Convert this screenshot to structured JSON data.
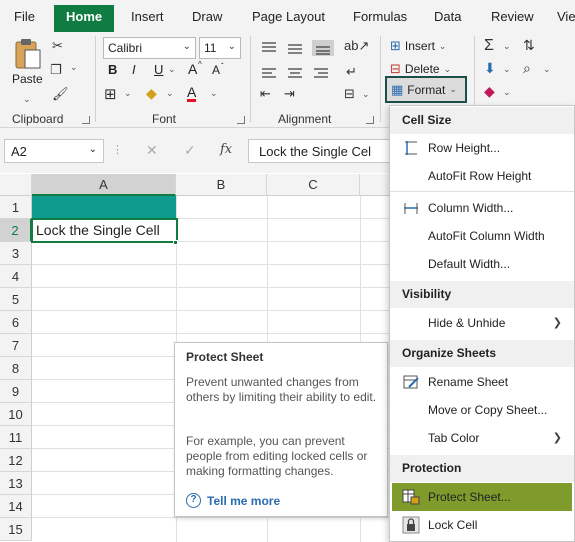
{
  "menu": {
    "tabs": [
      "File",
      "Home",
      "Insert",
      "Draw",
      "Page Layout",
      "Formulas",
      "Data",
      "Review",
      "Vie"
    ],
    "active": "Home",
    "accent": "#107c41"
  },
  "ribbon": {
    "clipboard": {
      "paste": "Paste",
      "label": "Clipboard"
    },
    "font": {
      "name": "Calibri",
      "size": "11",
      "bold": "B",
      "italic": "I",
      "underline": "U",
      "grow": "A",
      "shrink": "A",
      "label": "Font"
    },
    "alignment": {
      "label": "Alignment"
    },
    "cells": {
      "insert": "Insert",
      "delete": "Delete",
      "format": "Format"
    }
  },
  "formula_bar": {
    "name_box": "A2",
    "fx": "fx",
    "content": "Lock the Single Cel"
  },
  "grid": {
    "columns": [
      "A",
      "B",
      "C"
    ],
    "rows": [
      "1",
      "2",
      "3",
      "4",
      "5",
      "6",
      "7",
      "8",
      "9",
      "10",
      "11",
      "12",
      "13",
      "14",
      "15"
    ],
    "cell_a2": "Lock the Single Cell",
    "a1_fill": "#0f9b8e"
  },
  "tooltip": {
    "title": "Protect Sheet",
    "body1": "Prevent unwanted changes from others by limiting their ability to edit.",
    "body2": "For example, you can prevent people from editing locked cells or making formatting changes.",
    "link": "Tell me more"
  },
  "dropdown": {
    "cell_size": {
      "header": "Cell Size",
      "row_height": "Row Height...",
      "autofit_row": "AutoFit Row Height",
      "col_width": "Column Width...",
      "autofit_col": "AutoFit Column Width",
      "default_width": "Default Width..."
    },
    "visibility": {
      "header": "Visibility",
      "hide_unhide": "Hide & Unhide"
    },
    "organize": {
      "header": "Organize Sheets",
      "rename": "Rename Sheet",
      "move_copy": "Move or Copy Sheet...",
      "tab_color": "Tab Color"
    },
    "protection": {
      "header": "Protection",
      "protect": "Protect Sheet...",
      "lock": "Lock Cell"
    },
    "highlight_color": "#7f9b2b"
  }
}
